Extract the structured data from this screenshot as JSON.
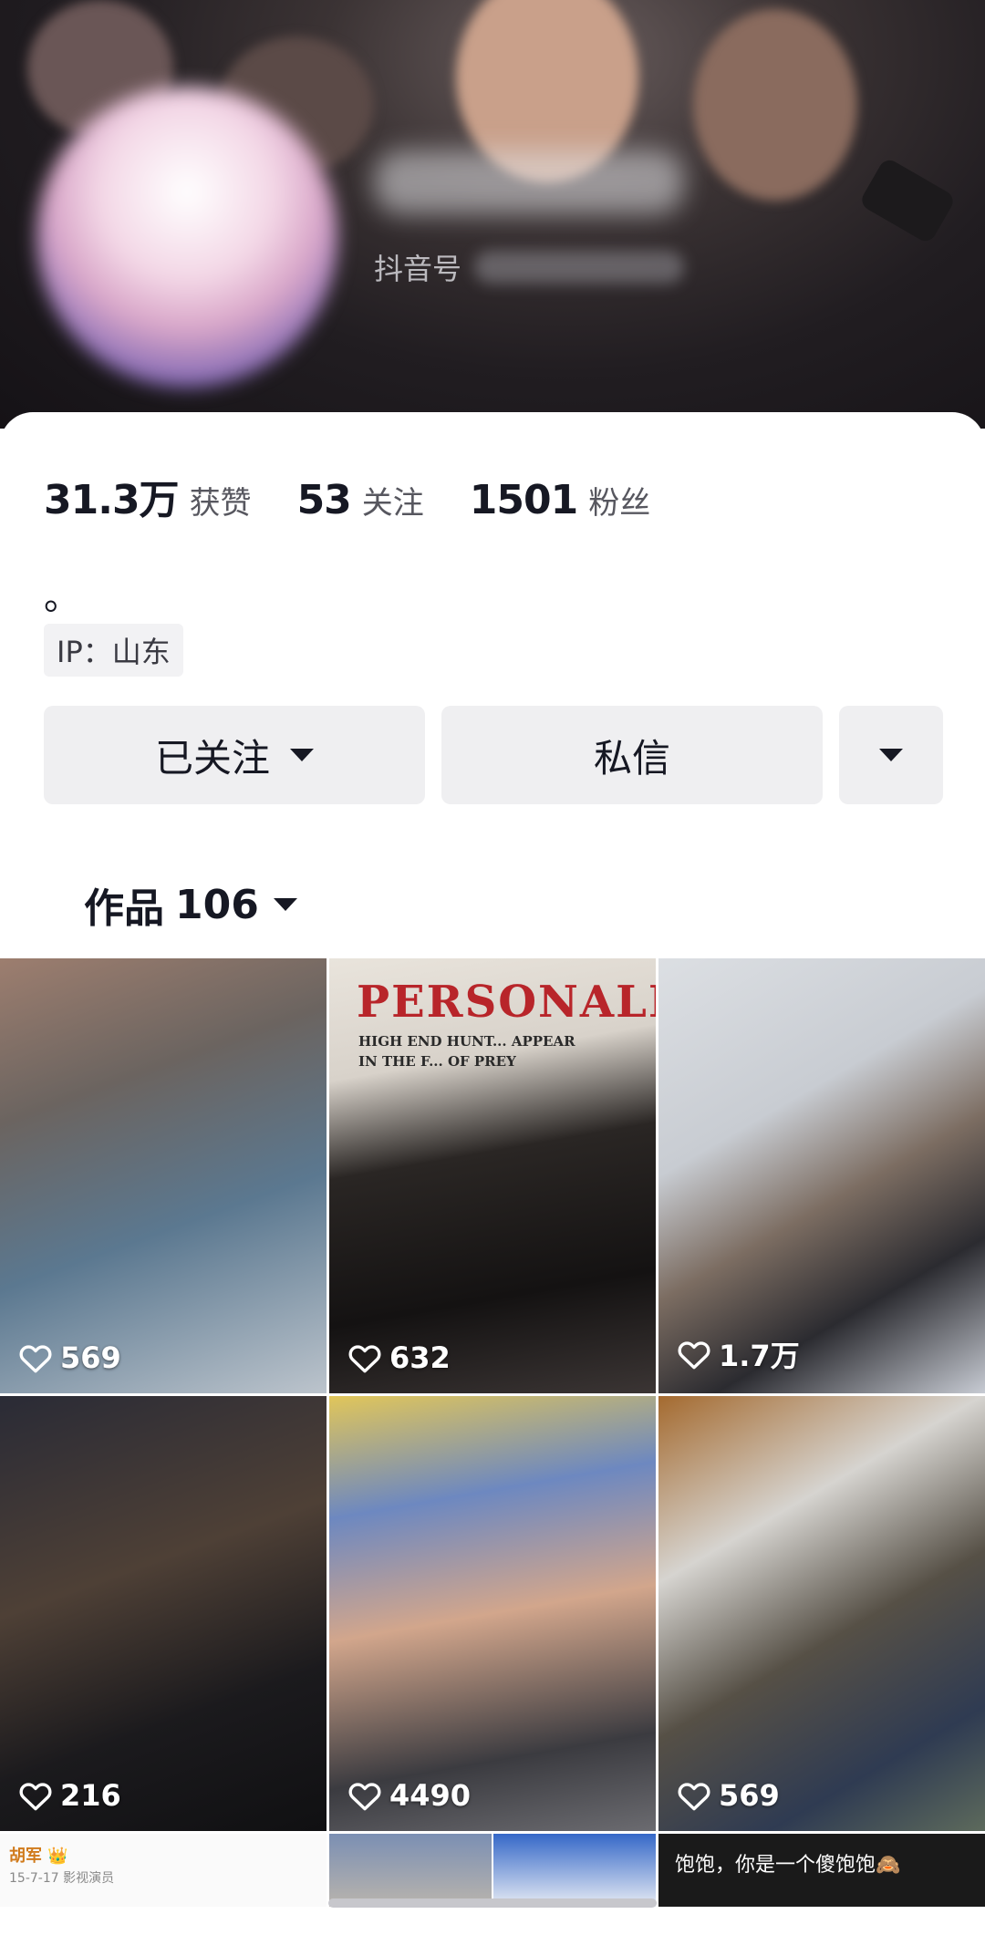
{
  "header": {
    "douyin_id_label": "抖音号"
  },
  "stats": [
    {
      "value": "31.3万",
      "label": "获赞"
    },
    {
      "value": "53",
      "label": "关注"
    },
    {
      "value": "1501",
      "label": "粉丝"
    }
  ],
  "bio": "。",
  "ip_location": "IP：山东",
  "actions": {
    "follow_label": "已关注",
    "message_label": "私信"
  },
  "works_tab": {
    "label": "作品",
    "count": "106"
  },
  "videos": [
    {
      "likes": "569"
    },
    {
      "likes": "632",
      "title_text": "PERSONALITY",
      "subtitle_text": "HIGH END HUNT... APPEAR IN THE F... OF PREY"
    },
    {
      "likes": "1.7万"
    },
    {
      "likes": "216"
    },
    {
      "likes": "4490"
    },
    {
      "likes": "569"
    }
  ],
  "bottom_row": {
    "tile1_name": "胡军 👑",
    "tile1_meta": "15-7-17  影视演员",
    "tile4_caption": "饱饱，你是一个傻饱饱🙈"
  },
  "colors": {
    "text_primary": "#161823",
    "button_bg": "#efeff1",
    "banner_bg": "#211d21"
  }
}
